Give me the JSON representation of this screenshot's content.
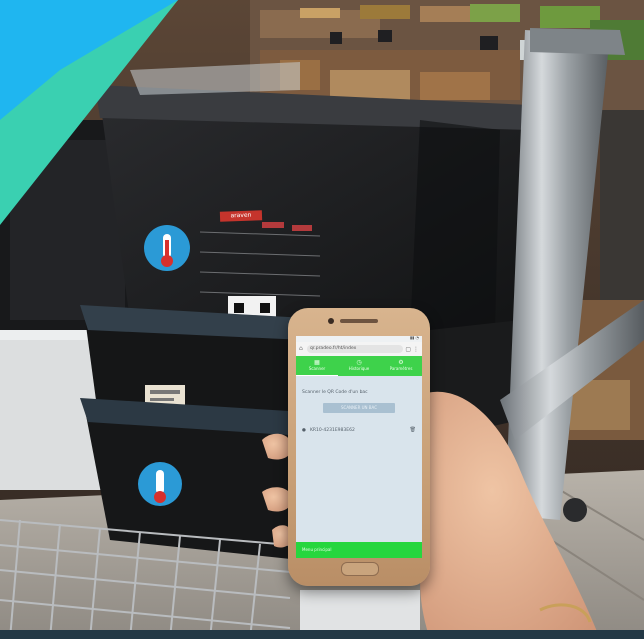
{
  "scene": {
    "description_colors": {
      "accent_blue": "#1fb6f0",
      "accent_teal": "#3ad0b1",
      "crate_dark": "#1b1c1e",
      "metal": "#a9adb0",
      "app_green": "#3ed24b"
    }
  },
  "crate": {
    "brand_label": "araven"
  },
  "phone_app": {
    "url": "qr.pradeo.fr/ht/index",
    "tabs": [
      {
        "label": "Scanner",
        "icon": "qr-icon"
      },
      {
        "label": "Historique",
        "icon": "history-icon"
      },
      {
        "label": "Paramètres",
        "icon": "gear-icon"
      }
    ],
    "prompt": "Scanner le QR Code d'un bac",
    "scan_button_label": "SCANNER UN BAC",
    "scanned_code": "KR10-4231E983E62",
    "footer_text": "Menu principal"
  }
}
